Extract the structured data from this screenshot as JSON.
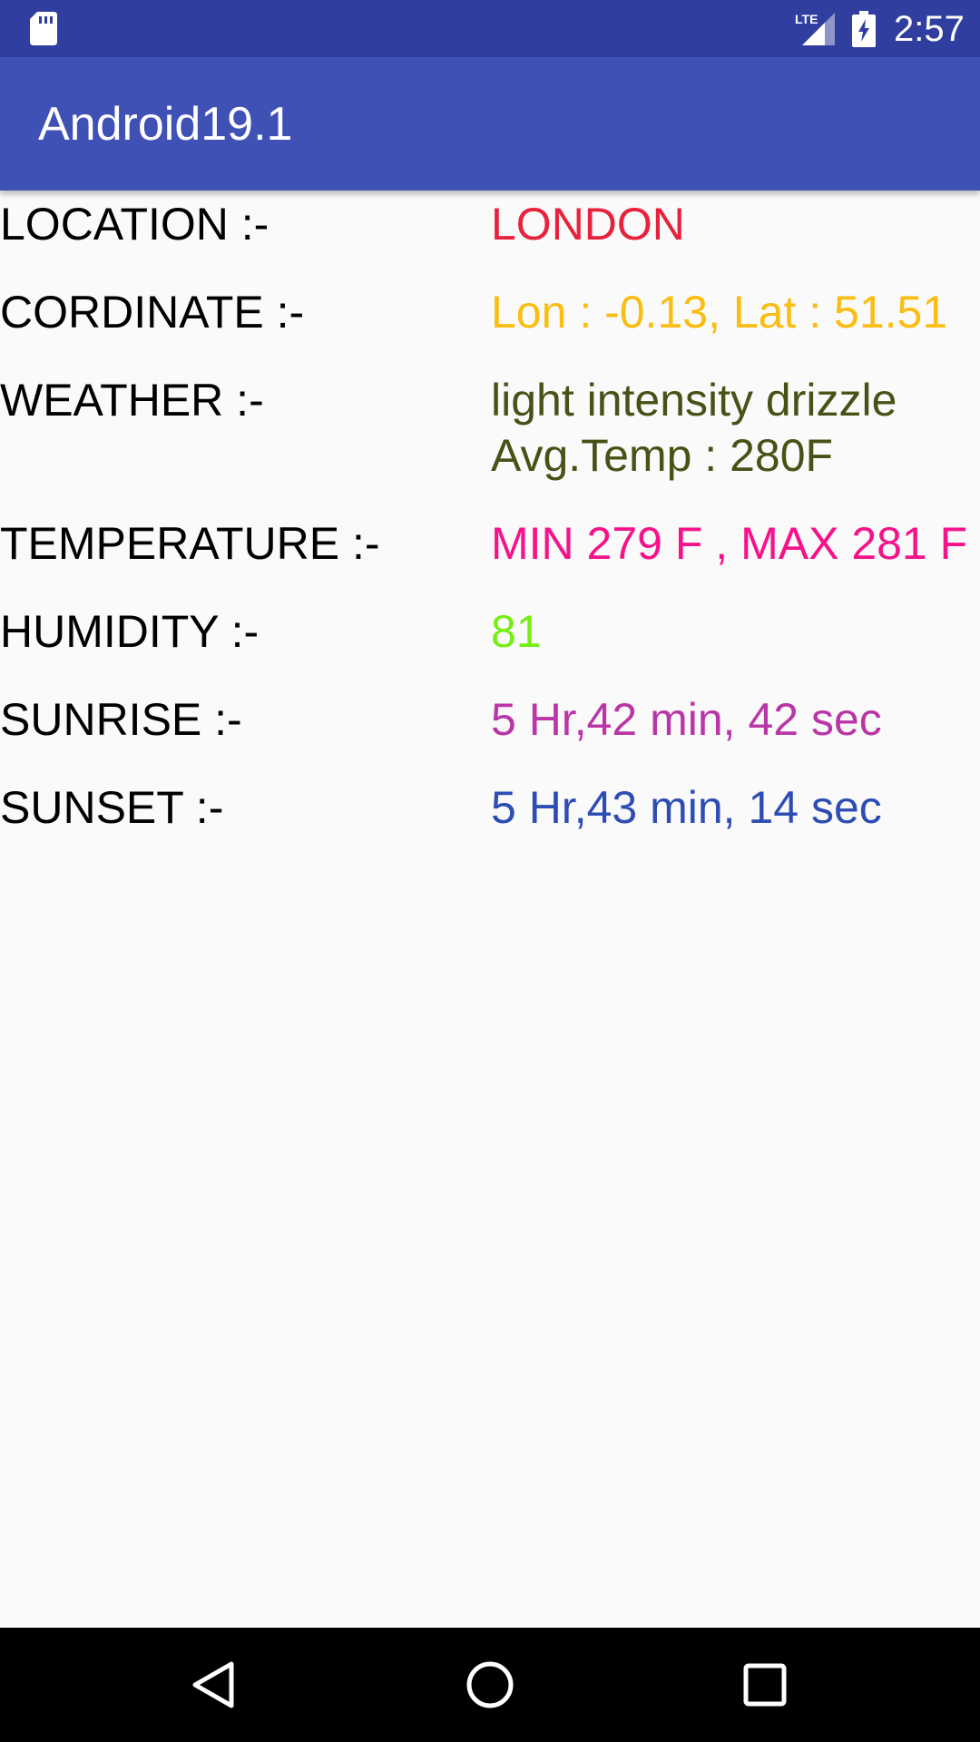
{
  "status_bar": {
    "time": "2:57",
    "network": "LTE",
    "icons": [
      "sd-card-icon",
      "signal-icon",
      "battery-charging-icon"
    ],
    "color": "#303f9f"
  },
  "app_bar": {
    "title": "Android19.1",
    "color": "#3f51b5"
  },
  "weather": {
    "location": {
      "label": "LOCATION :-",
      "value": "LONDON",
      "color": "#e8213c"
    },
    "coordinate": {
      "label": "CORDINATE :-",
      "value": "Lon : -0.13, Lat : 51.51",
      "color": "#fbbd11"
    },
    "weather": {
      "label": "WEATHER :-",
      "value_line1": "light intensity drizzle",
      "value_line2": "Avg.Temp : 280F",
      "color": "#4a5117"
    },
    "temperature": {
      "label": "TEMPERATURE :-",
      "value": "MIN 279 F , MAX 281 F",
      "color": "#f7118a"
    },
    "humidity": {
      "label": "HUMIDITY :-",
      "value": "81",
      "color": "#76ee12"
    },
    "sunrise": {
      "label": "SUNRISE :-",
      "value": "5 Hr,42 min, 42 sec",
      "color": "#ba36a7"
    },
    "sunset": {
      "label": "SUNSET :-",
      "value": "5 Hr,43 min, 14 sec",
      "color": "#2e4db4"
    }
  },
  "nav_bar": {
    "buttons": [
      "back-icon",
      "home-icon",
      "recents-icon"
    ]
  }
}
